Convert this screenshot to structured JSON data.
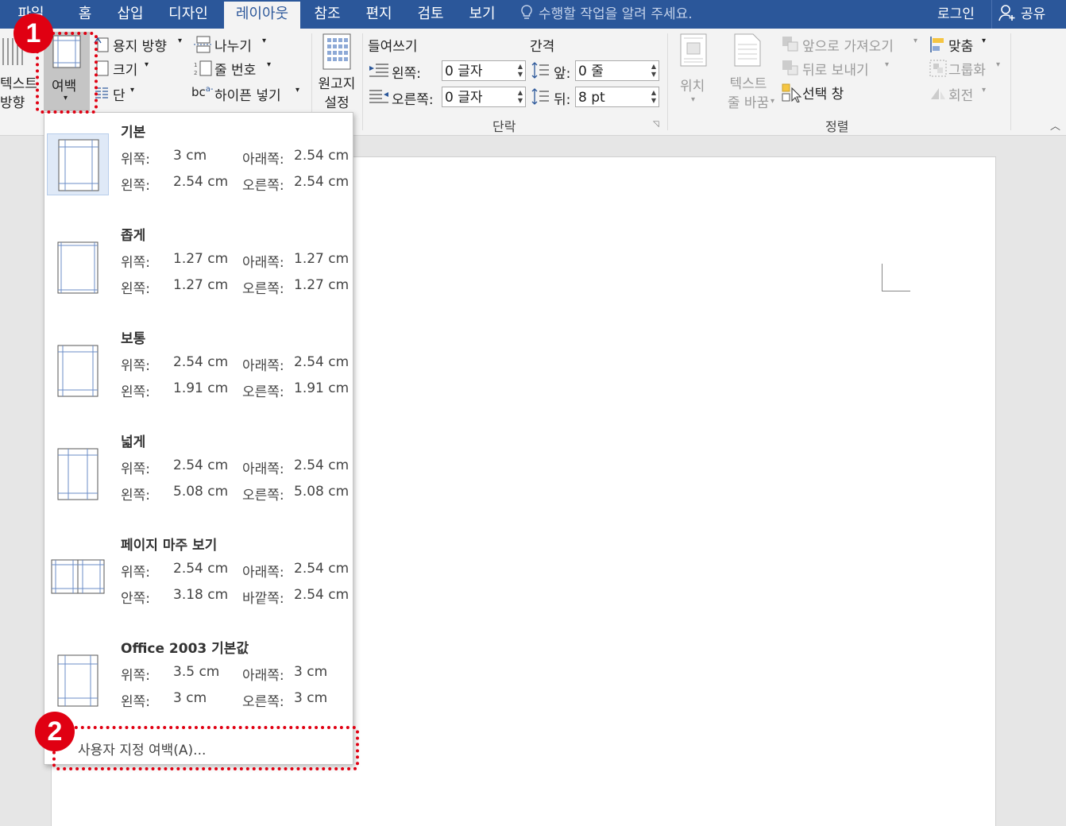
{
  "tabs": [
    {
      "label": "파일",
      "active": false
    },
    {
      "label": "홈",
      "active": false
    },
    {
      "label": "삽입",
      "active": false
    },
    {
      "label": "디자인",
      "active": false
    },
    {
      "label": "레이아웃",
      "active": true
    },
    {
      "label": "참조",
      "active": false
    },
    {
      "label": "편지",
      "active": false
    },
    {
      "label": "검토",
      "active": false
    },
    {
      "label": "보기",
      "active": false
    }
  ],
  "tell_me": "수행할 작업을 알려 주세요.",
  "sign_in": "로그인",
  "share": "공유",
  "ribbon": {
    "text_direction": [
      "텍스트",
      "방향"
    ],
    "margins": "여백",
    "orientation": "용지 방향",
    "size": "크기",
    "columns": "단",
    "breaks": "나누기",
    "line_numbers": "줄 번호",
    "hyphenation": "하이픈 넣기",
    "manuscript": [
      "원고지",
      "설정"
    ],
    "indent_header": "들여쓰기",
    "spacing_header": "간격",
    "indent_left_label": "왼쪽:",
    "indent_left_value": "0 글자",
    "indent_right_label": "오른쪽:",
    "indent_right_value": "0 글자",
    "spacing_before_label": "앞:",
    "spacing_before_value": "0 줄",
    "spacing_after_label": "뒤:",
    "spacing_after_value": "8 pt",
    "paragraph_group": "단락",
    "position": "위치",
    "wrap_text": [
      "텍스트",
      "줄 바꿈"
    ],
    "bring_forward": "앞으로 가져오기",
    "send_backward": "뒤로 보내기",
    "selection_pane": "선택 창",
    "align": "맞춤",
    "group": "그룹화",
    "rotate": "회전",
    "arrange_group": "정렬"
  },
  "margin_options": [
    {
      "name": "기본",
      "l1": "위쪽:",
      "v1": "3 cm",
      "l2": "아래쪽:",
      "v2": "2.54 cm",
      "l3": "왼쪽:",
      "v3": "2.54 cm",
      "l4": "오른쪽:",
      "v4": "2.54 cm"
    },
    {
      "name": "좁게",
      "l1": "위쪽:",
      "v1": "1.27 cm",
      "l2": "아래쪽:",
      "v2": "1.27 cm",
      "l3": "왼쪽:",
      "v3": "1.27 cm",
      "l4": "오른쪽:",
      "v4": "1.27 cm"
    },
    {
      "name": "보통",
      "l1": "위쪽:",
      "v1": "2.54 cm",
      "l2": "아래쪽:",
      "v2": "2.54 cm",
      "l3": "왼쪽:",
      "v3": "1.91 cm",
      "l4": "오른쪽:",
      "v4": "1.91 cm"
    },
    {
      "name": "넓게",
      "l1": "위쪽:",
      "v1": "2.54 cm",
      "l2": "아래쪽:",
      "v2": "2.54 cm",
      "l3": "왼쪽:",
      "v3": "5.08 cm",
      "l4": "오른쪽:",
      "v4": "5.08 cm"
    },
    {
      "name": "페이지 마주 보기",
      "l1": "위쪽:",
      "v1": "2.54 cm",
      "l2": "아래쪽:",
      "v2": "2.54 cm",
      "l3": "안쪽:",
      "v3": "3.18 cm",
      "l4": "바깥쪽:",
      "v4": "2.54 cm"
    },
    {
      "name": "Office 2003 기본값",
      "l1": "위쪽:",
      "v1": "3.5 cm",
      "l2": "아래쪽:",
      "v2": "3 cm",
      "l3": "왼쪽:",
      "v3": "3 cm",
      "l4": "오른쪽:",
      "v4": "3 cm"
    }
  ],
  "custom_margins": "사용자 지정 여백(A)...",
  "callouts": [
    "1",
    "2"
  ],
  "colors": {
    "accent": "#2b579a",
    "annotation": "#e00012"
  }
}
